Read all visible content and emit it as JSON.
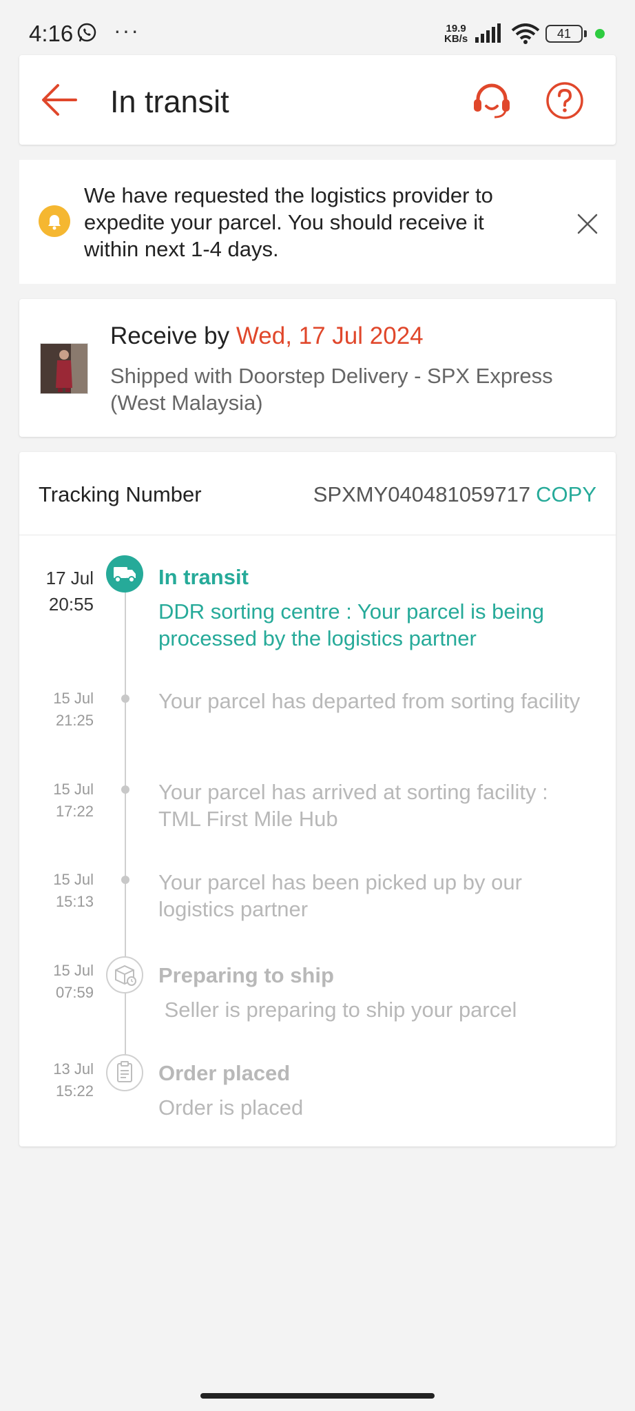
{
  "status_bar": {
    "time": "4:16",
    "more": "···",
    "speed_value": "19.9",
    "speed_unit": "KB/s",
    "battery": "41"
  },
  "header": {
    "title": "In transit"
  },
  "notice": {
    "text": "We have requested the logistics provider to expedite your parcel. You should receive it within next 1-4 days."
  },
  "delivery": {
    "receive_prefix": "Receive by ",
    "receive_date": "Wed, 17 Jul 2024",
    "shipped_with": "Shipped with Doorstep Delivery - SPX Express (West Malaysia)"
  },
  "tracking": {
    "label": "Tracking Number",
    "number": "SPXMY040481059717",
    "copy_label": "COPY",
    "events": [
      {
        "date": "17 Jul",
        "time": "20:55",
        "title": "In transit",
        "description": "DDR sorting centre : Your parcel is being processed by the logistics partner"
      },
      {
        "date": "15 Jul",
        "time": "21:25",
        "title": "",
        "description": "Your parcel has departed from sorting facility"
      },
      {
        "date": "15 Jul",
        "time": "17:22",
        "title": "",
        "description": "Your parcel has arrived at sorting facility : TML First Mile Hub"
      },
      {
        "date": "15 Jul",
        "time": "15:13",
        "title": "",
        "description": "Your parcel has been picked up by our logistics partner"
      },
      {
        "date": "15 Jul",
        "time": "07:59",
        "title": "Preparing to ship",
        "description": " Seller is preparing to ship your parcel"
      },
      {
        "date": "13 Jul",
        "time": "15:22",
        "title": "Order placed",
        "description": "Order is placed"
      }
    ]
  },
  "colors": {
    "accent": "#e0472b",
    "active_green": "#26aa99",
    "bell_yellow": "#f5b731"
  },
  "icons": {
    "back": "back-arrow-icon",
    "support": "headset-icon",
    "help": "question-icon",
    "bell": "bell-icon",
    "close": "close-icon",
    "truck": "truck-icon",
    "box": "box-icon",
    "clipboard": "clipboard-icon"
  }
}
